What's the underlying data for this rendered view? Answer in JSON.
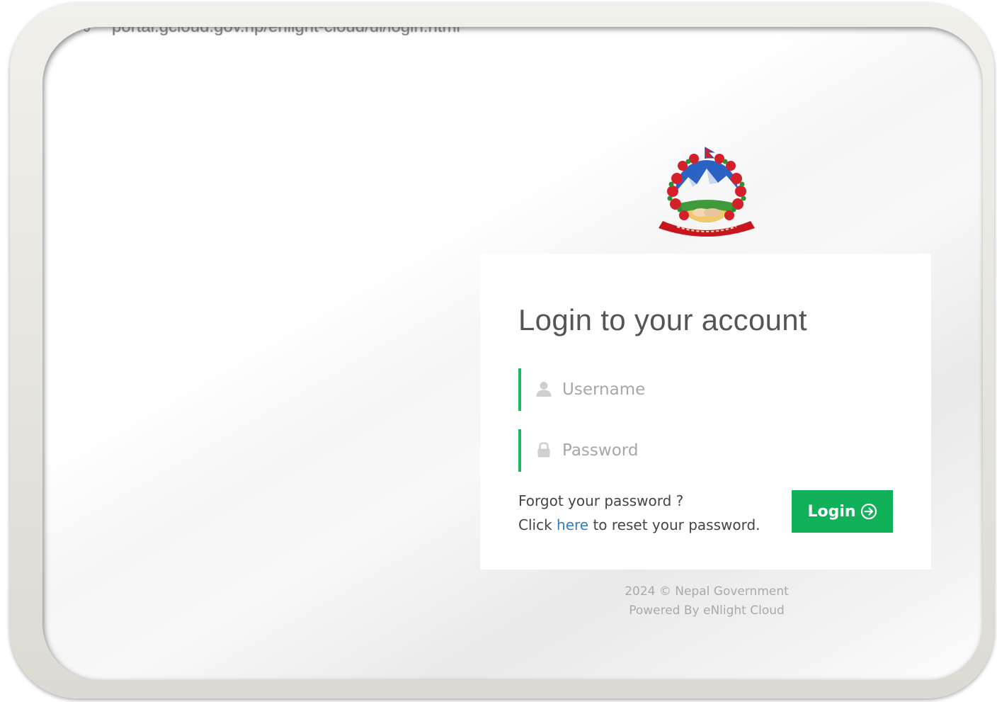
{
  "browser": {
    "url": "portal.gcloud.gov.np/enlight-cloud/ui/login.html"
  },
  "login": {
    "title": "Login to your account",
    "username_placeholder": "Username",
    "password_placeholder": "Password",
    "username_value": "",
    "password_value": "",
    "forgot_line": "Forgot your password ?",
    "reset_prefix": "Click ",
    "reset_link": "here",
    "reset_suffix": " to reset your password.",
    "button_label": "Login"
  },
  "footer": {
    "copyright": "2024 © Nepal Government",
    "powered_by": "Powered By eNlight Cloud"
  },
  "colors": {
    "accent_green": "#11b15a",
    "field_border_green": "#1fb865",
    "link_blue": "#2f7ec0"
  },
  "icons": {
    "emblem": "nepal-emblem-icon",
    "username": "user-icon",
    "password": "lock-icon",
    "button": "circle-arrow-right-icon",
    "address": "address-bar-dot-icon"
  }
}
